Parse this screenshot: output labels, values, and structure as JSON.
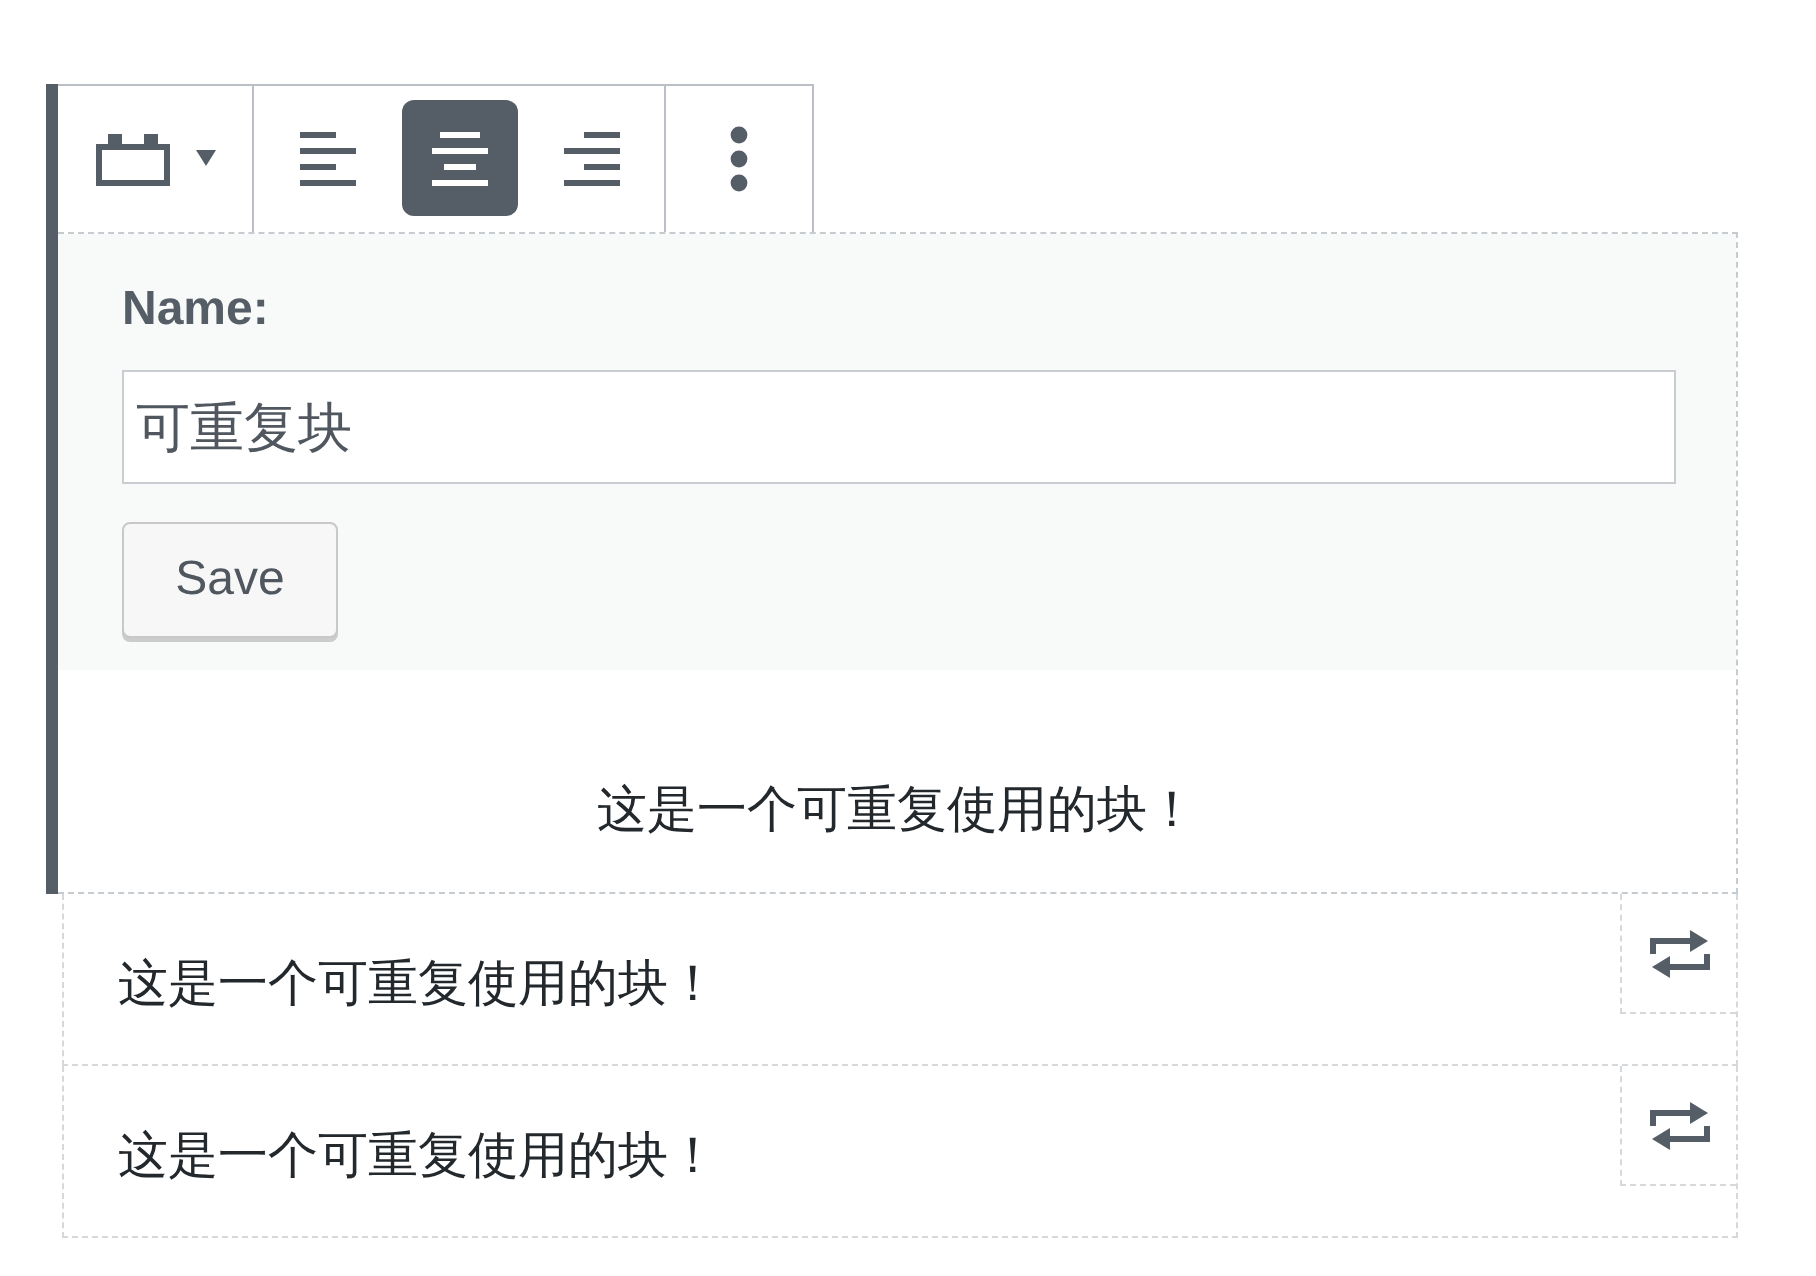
{
  "toolbar": {
    "alignment": [
      {
        "kind": "left",
        "selected": false
      },
      {
        "kind": "center",
        "selected": true
      },
      {
        "kind": "right",
        "selected": false
      }
    ]
  },
  "selected_block": {
    "name_form": {
      "label": "Name:",
      "value": "可重复块",
      "save_button": "Save"
    },
    "text": "这是一个可重复使用的块！"
  },
  "blocks": [
    {
      "text": "这是一个可重复使用的块！"
    },
    {
      "text": "这是一个可重复使用的块！"
    }
  ]
}
